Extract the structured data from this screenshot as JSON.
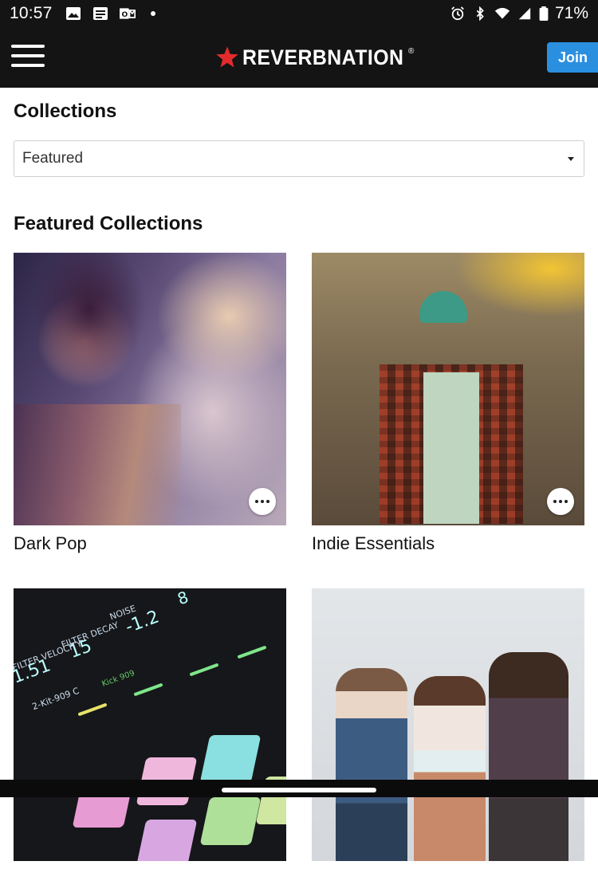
{
  "status_bar": {
    "time": "10:57",
    "battery": "71%",
    "left_icons": [
      "image-icon",
      "news-icon",
      "outlook-icon",
      "dot-icon"
    ],
    "right_icons": [
      "alarm-icon",
      "bluetooth-icon",
      "wifi-icon",
      "signal-icon",
      "battery-icon"
    ]
  },
  "header": {
    "logo_text": "REVERBNATION",
    "logo_mark": "®",
    "join_label": "Join",
    "brand_color": "#e32b2b",
    "join_color": "#2b8fe0"
  },
  "page": {
    "title": "Collections",
    "filter": {
      "selected": "Featured"
    },
    "section_title": "Featured Collections"
  },
  "collections": [
    {
      "title": "Dark Pop"
    },
    {
      "title": "Indie Essentials"
    },
    {
      "title": ""
    },
    {
      "title": ""
    }
  ],
  "drum_machine_labels": {
    "noise": "NOISE",
    "filter_decay": "FILTER DECAY",
    "velocity": "FILTER VELOCITY",
    "value_1": "-1.2",
    "value_2": "15",
    "value_3": "1.51",
    "value_4": "8",
    "kit": "2-Kit-909 C",
    "kick": "Kick 909"
  }
}
